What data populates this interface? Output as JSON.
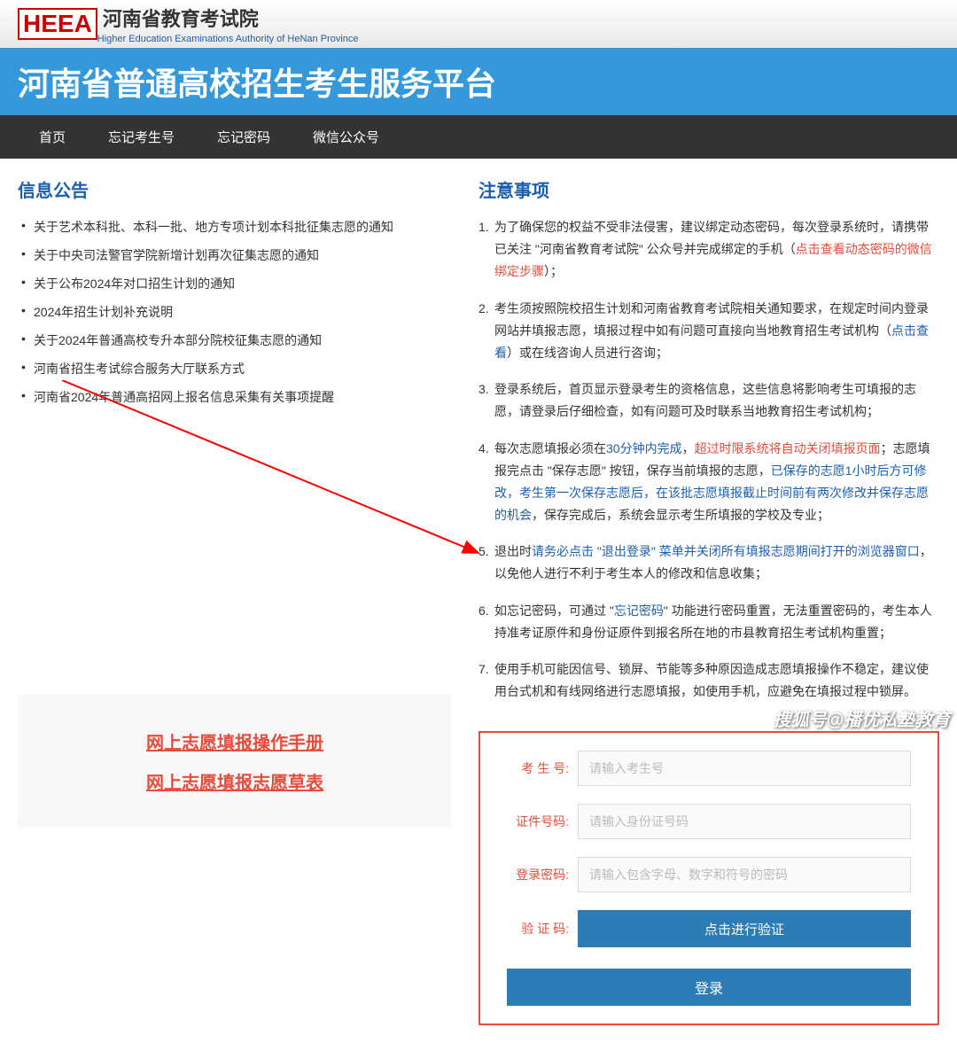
{
  "header": {
    "logo_abbr": "HEEA",
    "org_name_cn": "河南省教育考试院",
    "org_name_en": "Higher Education Examinations Authority of HeNan Province",
    "platform_title": "河南省普通高校招生考生服务平台"
  },
  "nav": {
    "items": [
      "首页",
      "忘记考生号",
      "忘记密码",
      "微信公众号"
    ]
  },
  "bulletin": {
    "title": "信息公告",
    "items": [
      "关于艺术本科批、本科一批、地方专项计划本科批征集志愿的通知",
      "关于中央司法警官学院新增计划再次征集志愿的通知",
      "关于公布2024年对口招生计划的通知",
      "2024年招生计划补充说明",
      "关于2024年普通高校专升本部分院校征集志愿的通知",
      "河南省招生考试综合服务大厅联系方式",
      "河南省2024年普通高招网上报名信息采集有关事项提醒"
    ]
  },
  "notice": {
    "title": "注意事项",
    "item1_a": "为了确保您的权益不受非法侵害，建议绑定动态密码，每次登录系统时，请携带已关注 \"河南省教育考试院\" 公众号并完成绑定的手机（",
    "item1_link": "点击查看动态密码的微信绑定步骤",
    "item1_b": "）；",
    "item2_a": "考生须按照院校招生计划和河南省教育考试院相关通知要求，在规定时间内登录网站并填报志愿，填报过程中如有问题可直接向当地教育招生考试机构（",
    "item2_link": "点击查看",
    "item2_b": "）或在线咨询人员进行咨询；",
    "item3": "登录系统后，首页显示登录考生的资格信息，这些信息将影响考生可填报的志愿，请登录后仔细检查，如有问题可及时联系当地教育招生考试机构；",
    "item4_a": "每次志愿填报必须在",
    "item4_blue1": "30分钟内完成",
    "item4_b": "，",
    "item4_red": "超过时限系统将自动关闭填报页面",
    "item4_c": "；志愿填报完点击 \"保存志愿\" 按钮，保存当前填报的志愿，",
    "item4_blue2": "已保存的志愿1小时后方可修改，考生第一次保存志愿后，在该批志愿填报截止时间前有两次修改并保存志愿的机会",
    "item4_d": "，保存完成后，系统会显示考生所填报的学校及专业；",
    "item5_a": "退出时",
    "item5_blue": "请务必点击 \"退出登录\" 菜单并关闭所有填报志愿期间打开的浏览器窗口",
    "item5_b": "，以免他人进行不利于考生本人的修改和信息收集；",
    "item6_a": "如忘记密码，可通过 \"",
    "item6_link": "忘记密码",
    "item6_b": "\" 功能进行密码重置，无法重置密码的，考生本人持准考证原件和身份证原件到报名所在地的市县教育招生考试机构重置；",
    "item7": "使用手机可能因信号、锁屏、节能等多种原因造成志愿填报操作不稳定，建议使用台式机和有线网络进行志愿填报，如使用手机，应避免在填报过程中锁屏。"
  },
  "manual": {
    "link1": "网上志愿填报操作手册",
    "link2": "网上志愿填报志愿草表"
  },
  "login": {
    "label_student_id": "考 生 号:",
    "placeholder_student_id": "请输入考生号",
    "label_id_number": "证件号码:",
    "placeholder_id_number": "请输入身份证号码",
    "label_password": "登录密码:",
    "placeholder_password": "请输入包含字母、数字和符号的密码",
    "label_verify": "验 证 码:",
    "verify_button": "点击进行验证",
    "login_button": "登录"
  },
  "watermark": "搜狐号@播优私塾教育"
}
